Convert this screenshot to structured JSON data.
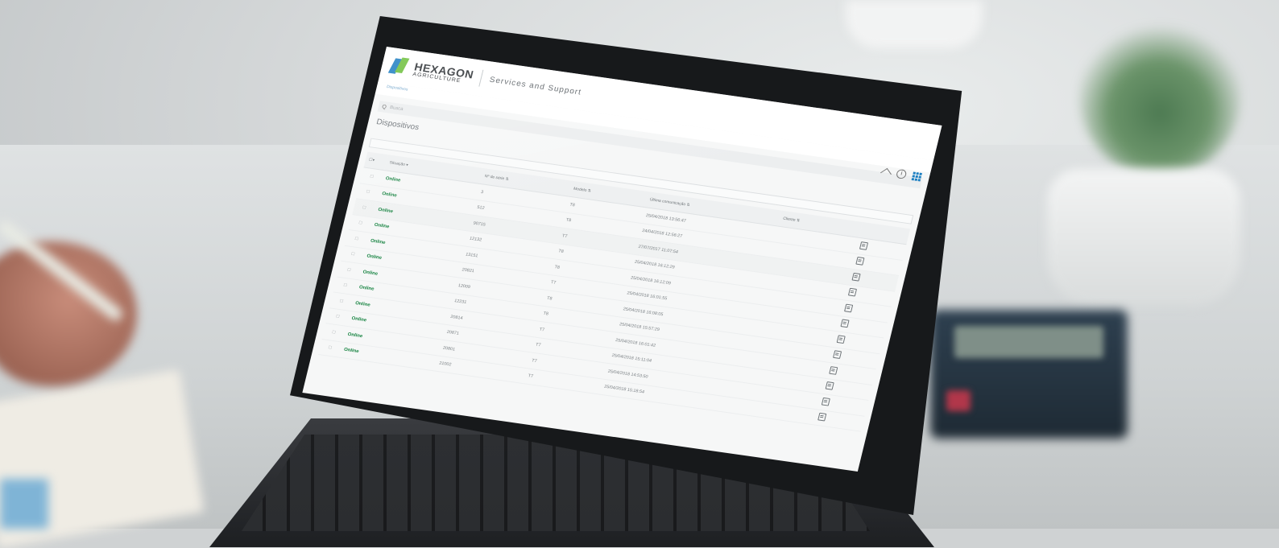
{
  "header": {
    "logo_main": "HEXAGON",
    "logo_sub": "AGRICULTURE",
    "service_title": "Services and Support",
    "breadcrumb": "Dispositivos"
  },
  "search": {
    "icon_label": "Q",
    "placeholder": "Busca"
  },
  "icons": {
    "home": "home-icon",
    "info": "info-icon",
    "apps": "grid-icon"
  },
  "page": {
    "title": "Dispositivos"
  },
  "colors": {
    "online": "#14823f",
    "brand_blue": "#1b7fc2",
    "brand_green": "#6cbf3a"
  },
  "table": {
    "select_label": "☐▾",
    "columns": [
      "Situação ▾",
      "Nº de série ⇅",
      "Modelo ⇅",
      "Última comunicação ⇅",
      "Cliente ⇅",
      ""
    ],
    "rows": [
      {
        "status": "Online",
        "serial": "3",
        "model": "T8",
        "last": "25/04/2018 13:56:47",
        "client": ""
      },
      {
        "status": "Online",
        "serial": "512",
        "model": "T8",
        "last": "24/04/2018 12:56:27",
        "client": ""
      },
      {
        "status": "Online",
        "serial": "90715",
        "model": "T7",
        "last": "27/07/2017 11:07:54",
        "client": ""
      },
      {
        "status": "Online",
        "serial": "12132",
        "model": "T8",
        "last": "25/04/2018 16:12:29",
        "client": ""
      },
      {
        "status": "Online",
        "serial": "13151",
        "model": "T8",
        "last": "25/04/2018 16:12:09",
        "client": ""
      },
      {
        "status": "Online",
        "serial": "20821",
        "model": "T7",
        "last": "25/04/2018 16:01:55",
        "client": ""
      },
      {
        "status": "Online",
        "serial": "12009",
        "model": "T8",
        "last": "25/04/2018 16:08:05",
        "client": ""
      },
      {
        "status": "Online",
        "serial": "12231",
        "model": "T8",
        "last": "25/04/2018 15:57:29",
        "client": ""
      },
      {
        "status": "Online",
        "serial": "20814",
        "model": "T7",
        "last": "25/04/2018 16:01:42",
        "client": ""
      },
      {
        "status": "Online",
        "serial": "20871",
        "model": "T7",
        "last": "25/04/2018 15:11:04",
        "client": ""
      },
      {
        "status": "Online",
        "serial": "20801",
        "model": "T7",
        "last": "25/04/2018 14:53:50",
        "client": ""
      },
      {
        "status": "Online",
        "serial": "21002",
        "model": "T7",
        "last": "25/04/2018 15:18:54",
        "client": ""
      }
    ]
  }
}
